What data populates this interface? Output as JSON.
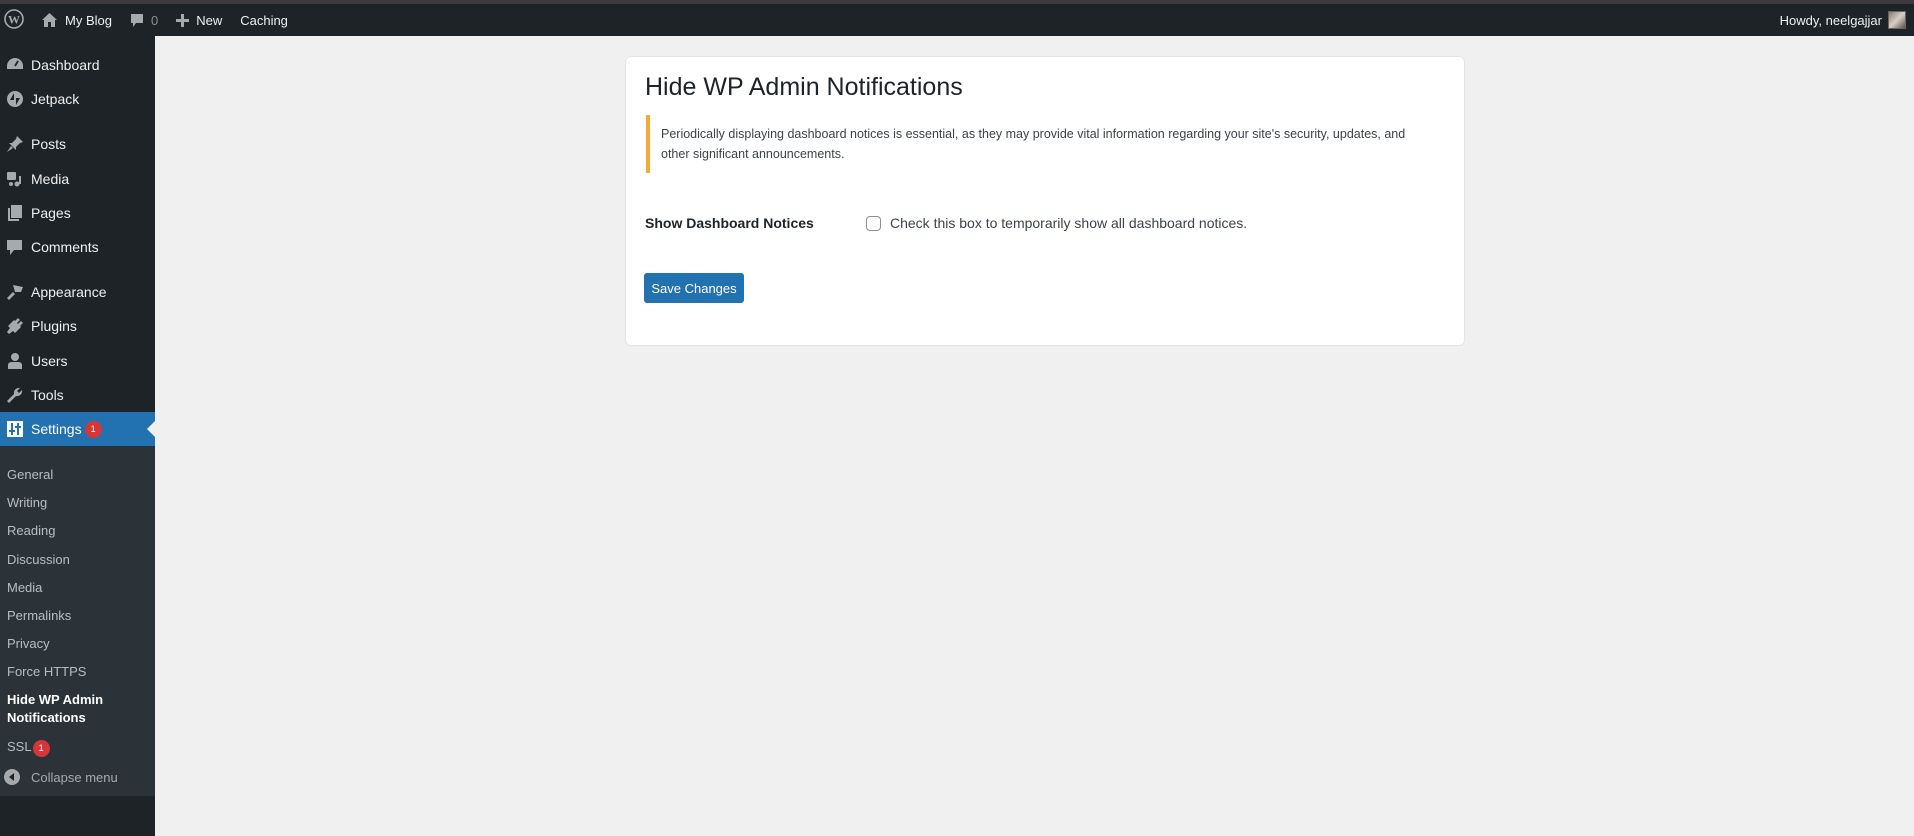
{
  "adminbar": {
    "site_name": "My Blog",
    "comments_count": "0",
    "new_label": "New",
    "caching_label": "Caching",
    "howdy": "Howdy, neelgajjar"
  },
  "sidebar": {
    "items": [
      {
        "label": "Dashboard",
        "icon": "dashboard-icon"
      },
      {
        "label": "Jetpack",
        "icon": "jetpack-icon"
      },
      {
        "label": "Posts",
        "icon": "pin-icon"
      },
      {
        "label": "Media",
        "icon": "media-icon"
      },
      {
        "label": "Pages",
        "icon": "pages-icon"
      },
      {
        "label": "Comments",
        "icon": "comment-icon"
      },
      {
        "label": "Appearance",
        "icon": "brush-icon"
      },
      {
        "label": "Plugins",
        "icon": "plug-icon"
      },
      {
        "label": "Users",
        "icon": "user-icon"
      },
      {
        "label": "Tools",
        "icon": "wrench-icon"
      },
      {
        "label": "Settings",
        "icon": "settings-icon",
        "badge": "1",
        "active": true
      }
    ],
    "submenu": [
      {
        "label": "General"
      },
      {
        "label": "Writing"
      },
      {
        "label": "Reading"
      },
      {
        "label": "Discussion"
      },
      {
        "label": "Media"
      },
      {
        "label": "Permalinks"
      },
      {
        "label": "Privacy"
      },
      {
        "label": "Force HTTPS"
      },
      {
        "label": "Hide WP Admin",
        "label2": "Notifications",
        "current": true
      },
      {
        "label": "SSL",
        "badge": "1"
      }
    ],
    "collapse_label": "Collapse menu"
  },
  "main": {
    "title": "Hide WP Admin Notifications",
    "notice_line1": "Periodically displaying dashboard notices is essential, as they may provide vital information regarding your site's security, updates, and",
    "notice_line2": "other significant announcements.",
    "field_label": "Show Dashboard Notices",
    "checkbox_checked": false,
    "checkbox_label": "Check this box to temporarily show all dashboard notices.",
    "save_label": "Save Changes"
  },
  "colors": {
    "accent": "#2271b1",
    "notice_border": "#f6a938",
    "badge": "#d63638",
    "sidebar_bg": "#1d2327"
  }
}
